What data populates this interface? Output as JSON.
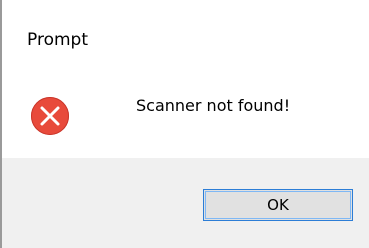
{
  "window": {
    "title": "Prompt"
  },
  "dialog": {
    "icon": "error-icon",
    "message": "Scanner not found!",
    "ok_label": "OK"
  },
  "colors": {
    "error_icon": "#e84a3b",
    "button_border": "#2c7dd6",
    "footer_bg": "#f0f0f0"
  }
}
